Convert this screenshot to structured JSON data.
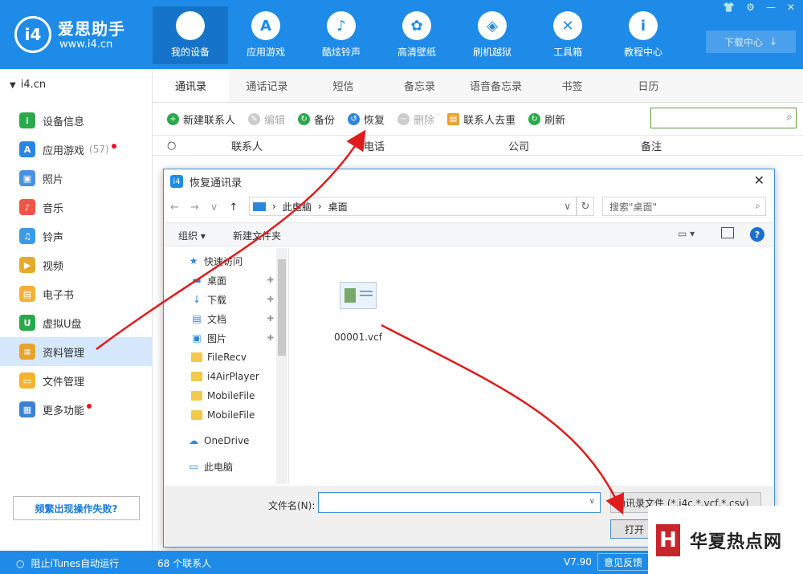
{
  "app": {
    "brand": "爱思助手",
    "url": "www.i4.cn",
    "logo_text": "i4"
  },
  "nav": [
    {
      "label": "我的设备",
      "icon": "apple-icon",
      "glyph": "",
      "active": true
    },
    {
      "label": "应用游戏",
      "icon": "appstore-icon",
      "glyph": "A"
    },
    {
      "label": "酷炫铃声",
      "icon": "bell-icon",
      "glyph": "♪"
    },
    {
      "label": "高清壁纸",
      "icon": "flower-icon",
      "glyph": "✿"
    },
    {
      "label": "刷机越狱",
      "icon": "box-icon",
      "glyph": "◈"
    },
    {
      "label": "工具箱",
      "icon": "tools-icon",
      "glyph": "✕"
    },
    {
      "label": "教程中心",
      "icon": "info-icon",
      "glyph": "i"
    }
  ],
  "window_controls": [
    "👕",
    "⚙",
    "—",
    "✕"
  ],
  "download_center": {
    "label": "下载中心",
    "icon": "↓"
  },
  "device": {
    "name": "i4.cn"
  },
  "sidebar": {
    "items": [
      {
        "label": "设备信息",
        "icon": "info-icon",
        "color": "#2aa84a",
        "glyph": "i"
      },
      {
        "label": "应用游戏",
        "icon": "appstore-icon",
        "color": "#2b86e0",
        "glyph": "A",
        "count": "(57)",
        "dot": true
      },
      {
        "label": "照片",
        "icon": "photo-icon",
        "color": "#4a90e2",
        "glyph": "▣"
      },
      {
        "label": "音乐",
        "icon": "music-icon",
        "color": "#f05545",
        "glyph": "♪"
      },
      {
        "label": "铃声",
        "icon": "bell-icon",
        "color": "#3b9be8",
        "glyph": "♫"
      },
      {
        "label": "视频",
        "icon": "video-icon",
        "color": "#e5a92b",
        "glyph": "▶"
      },
      {
        "label": "电子书",
        "icon": "book-icon",
        "color": "#f2b233",
        "glyph": "▤"
      },
      {
        "label": "虚拟U盘",
        "icon": "usb-icon",
        "color": "#2aa84a",
        "glyph": "U"
      },
      {
        "label": "资料管理",
        "icon": "contacts-icon",
        "color": "#e8a32b",
        "glyph": "≡",
        "active": true
      },
      {
        "label": "文件管理",
        "icon": "file-icon",
        "color": "#f0b42e",
        "glyph": "▭"
      },
      {
        "label": "更多功能",
        "icon": "grid-icon",
        "color": "#3b82d4",
        "glyph": "▦",
        "dot": true
      }
    ],
    "help_label": "频繁出现操作失败?"
  },
  "tabs": [
    "通讯录",
    "通话记录",
    "短信",
    "备忘录",
    "语音备忘录",
    "书签",
    "日历"
  ],
  "toolbar": {
    "new_contact": "新建联系人",
    "edit": "编辑",
    "backup": "备份",
    "restore": "恢复",
    "delete": "删除",
    "dedupe": "联系人去重",
    "refresh": "刷新"
  },
  "columns": [
    "联系人",
    "电话",
    "公司",
    "备注"
  ],
  "dialog": {
    "title": "恢复通讯录",
    "breadcrumb": [
      "此电脑",
      "桌面"
    ],
    "search_placeholder": "搜索\"桌面\"",
    "organize": "组织 ▾",
    "new_folder": "新建文件夹",
    "tree": [
      {
        "label": "快速访问",
        "icon": "star-icon",
        "glyph": "★",
        "level": 1
      },
      {
        "label": "桌面",
        "icon": "desktop-icon",
        "glyph": "▬",
        "level": 2,
        "pin": true
      },
      {
        "label": "下载",
        "icon": "download-icon",
        "glyph": "↓",
        "level": 2,
        "pin": true
      },
      {
        "label": "文档",
        "icon": "document-icon",
        "glyph": "▤",
        "level": 2,
        "pin": true
      },
      {
        "label": "图片",
        "icon": "picture-icon",
        "glyph": "▣",
        "level": 2,
        "pin": true
      },
      {
        "label": "FileRecv",
        "icon": "folder-icon",
        "level": 2
      },
      {
        "label": "i4AirPlayer",
        "icon": "folder-icon",
        "level": 2
      },
      {
        "label": "MobileFile",
        "icon": "folder-icon",
        "level": 2
      },
      {
        "label": "MobileFile",
        "icon": "folder-icon",
        "level": 2
      },
      {
        "label": "OneDrive",
        "icon": "cloud-icon",
        "glyph": "☁",
        "level": 1
      },
      {
        "label": "此电脑",
        "icon": "computer-icon",
        "glyph": "▭",
        "level": 1
      }
    ],
    "file": "00001.vcf",
    "filename_label": "文件名(N):",
    "filename_value": "",
    "file_type": "通讯录文件 (*.i4c,*.vcf,*.csv)",
    "open_button": "打开"
  },
  "status": {
    "itunes": "阻止iTunes自动运行",
    "contact_count": "68 个联系人",
    "version": "V7.90",
    "feedback": "意见反馈"
  },
  "watermark": {
    "logo": "H",
    "text": "华夏热点网"
  },
  "colors": {
    "primary": "#1e8be8",
    "active_nav": "#1574c9",
    "arrow": "#e01b1b"
  }
}
